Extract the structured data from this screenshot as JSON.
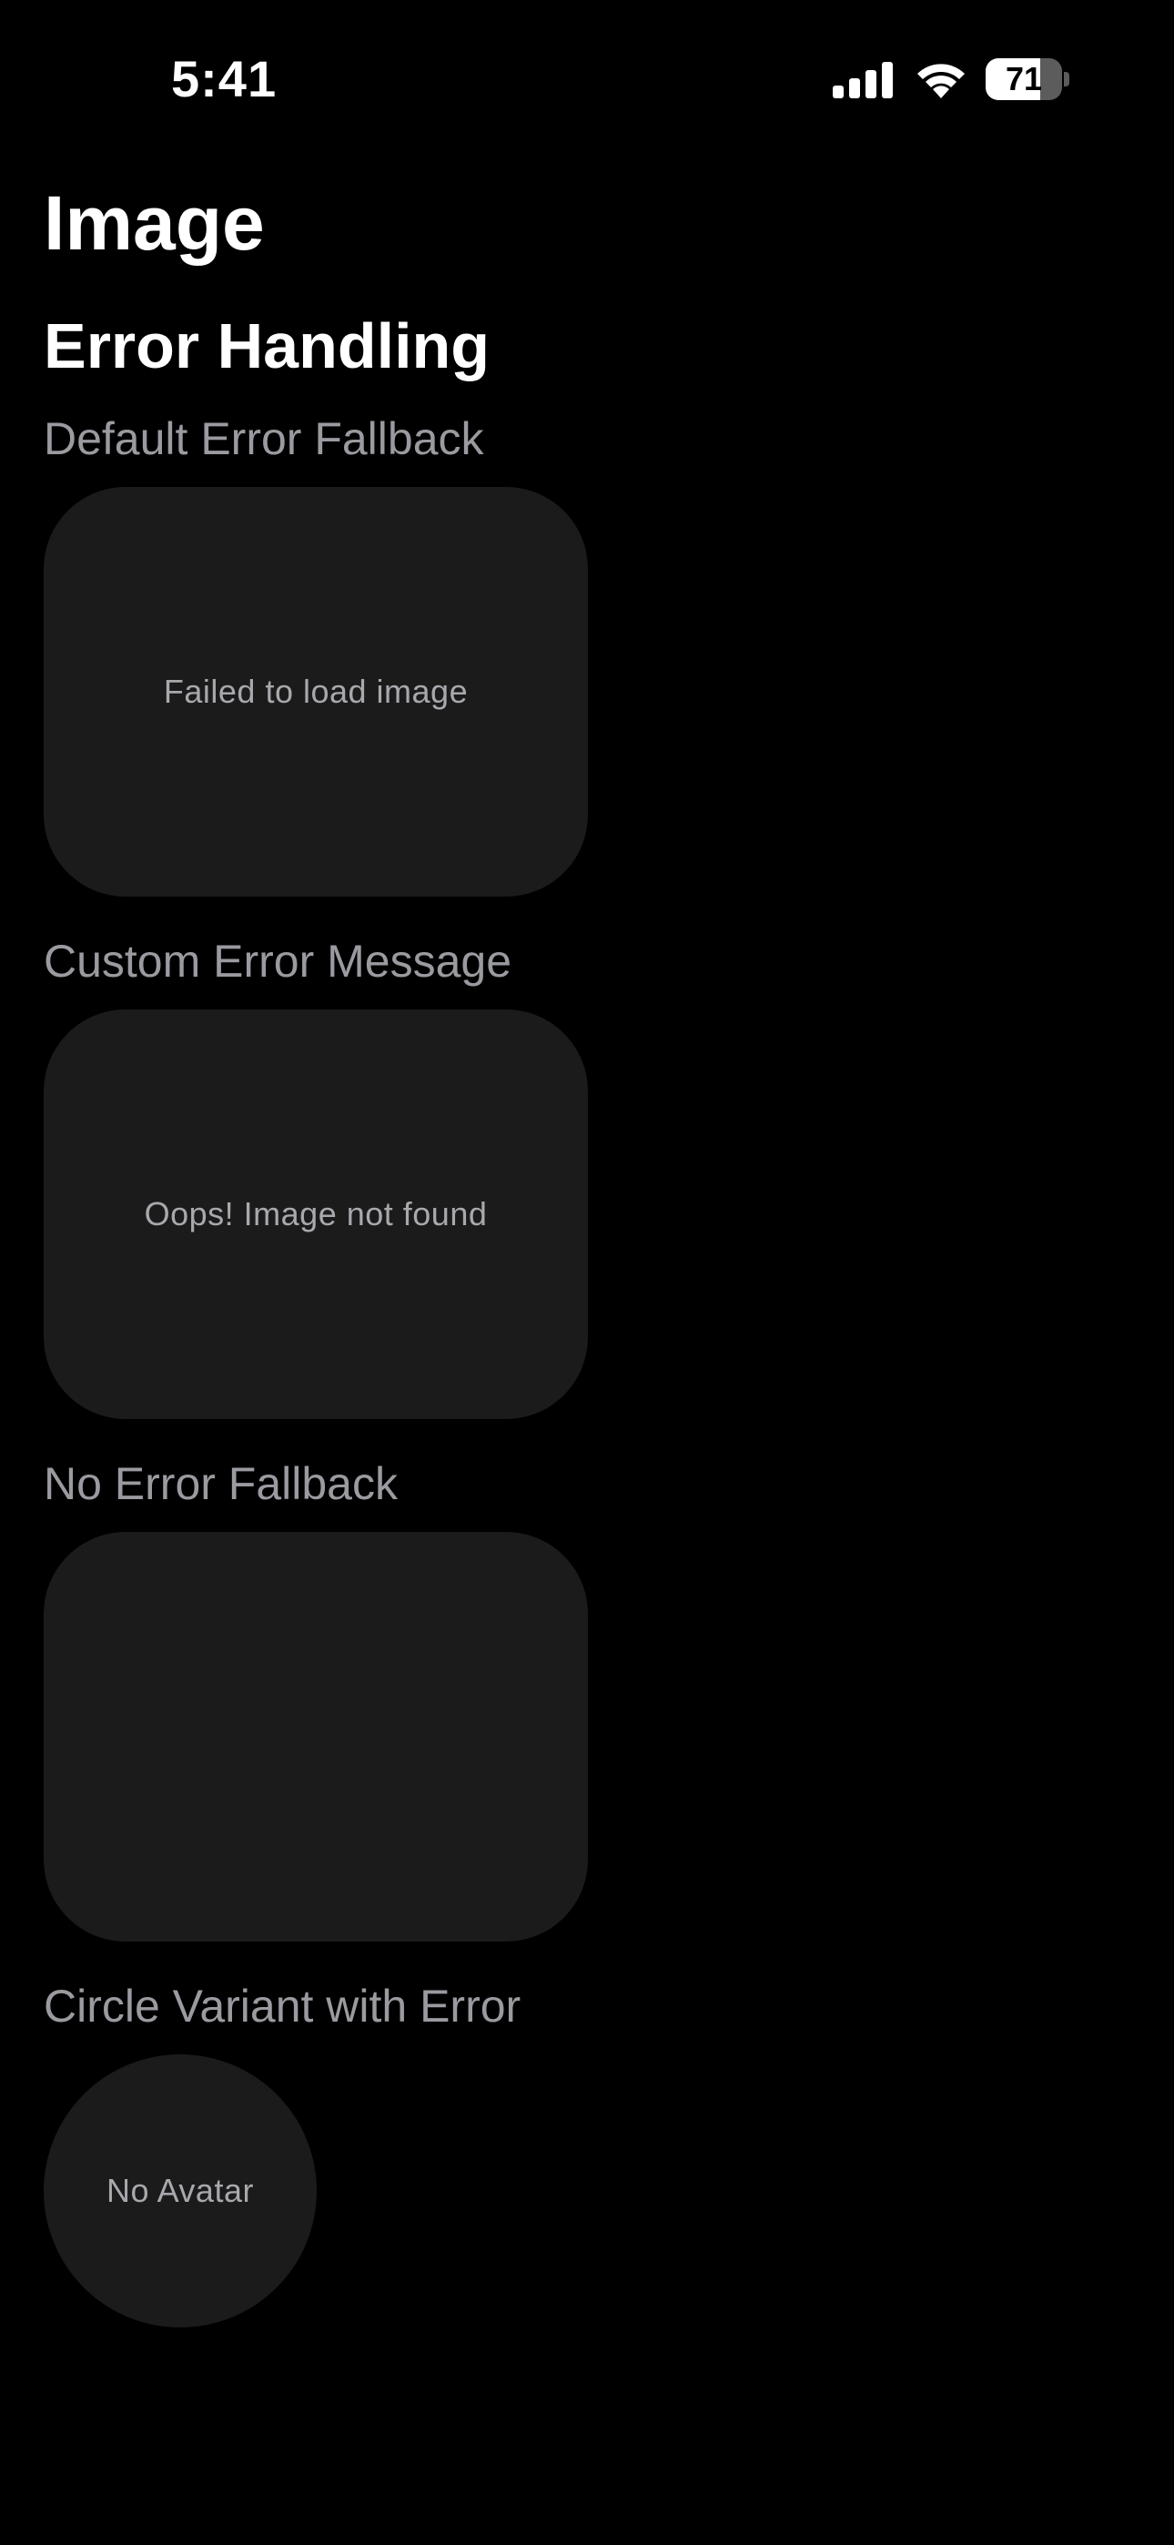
{
  "status_bar": {
    "time": "5:41",
    "battery_level": "71",
    "battery_fraction": 0.71,
    "icons": [
      "signal-icon",
      "wifi-icon",
      "battery-icon"
    ]
  },
  "page": {
    "title": "Image"
  },
  "section": {
    "title": "Error Handling",
    "examples": [
      {
        "label": "Default Error Fallback",
        "message": "Failed to load image"
      },
      {
        "label": "Custom Error Message",
        "message": "Oops! Image not found"
      },
      {
        "label": "No Error Fallback",
        "message": ""
      },
      {
        "label": "Circle Variant with Error",
        "message": "No Avatar"
      }
    ]
  },
  "colors": {
    "background": "#000000",
    "placeholder": "#1b1b1c",
    "label_text": "#9a9aa0",
    "error_text": "#a8a8ad"
  }
}
